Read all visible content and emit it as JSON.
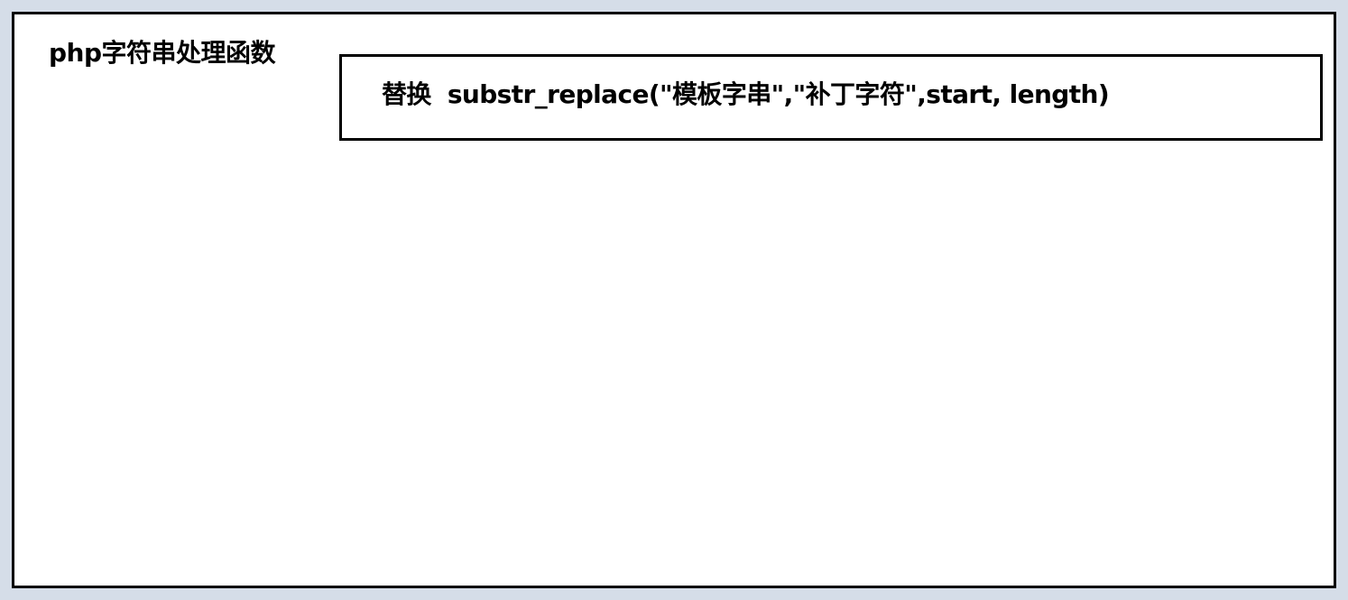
{
  "diagram": {
    "title": "php字符串处理函数",
    "node": {
      "label": "替换",
      "code": "substr_replace(\"模板字串\",\"补丁字符\",start,  length)"
    }
  }
}
